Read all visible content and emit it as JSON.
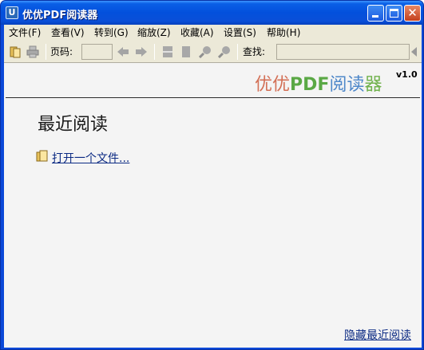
{
  "window": {
    "title": "优优PDF阅读器",
    "app_icon_letter": "U",
    "close_glyph": "✕"
  },
  "menubar": {
    "items": [
      {
        "label": "文件(F)"
      },
      {
        "label": "查看(V)"
      },
      {
        "label": "转到(G)"
      },
      {
        "label": "缩放(Z)"
      },
      {
        "label": "收藏(A)"
      },
      {
        "label": "设置(S)"
      },
      {
        "label": "帮助(H)"
      }
    ]
  },
  "toolbar": {
    "page_label": "页码:",
    "page_value": "",
    "search_label": "查找:",
    "search_value": "",
    "icons": [
      "open-file-icon",
      "print-icon",
      "prev-page-icon",
      "next-page-icon",
      "fit-width-icon",
      "fit-page-icon",
      "zoom-in-icon",
      "zoom-out-icon",
      "search-go-icon"
    ]
  },
  "brand": {
    "part1": "优优",
    "part2": "PDF",
    "part3": "阅读",
    "part4": "器",
    "version": "v1.0"
  },
  "recent": {
    "title": "最近阅读",
    "open_file": "打开一个文件...",
    "hide_recent": "隐藏最近阅读"
  }
}
